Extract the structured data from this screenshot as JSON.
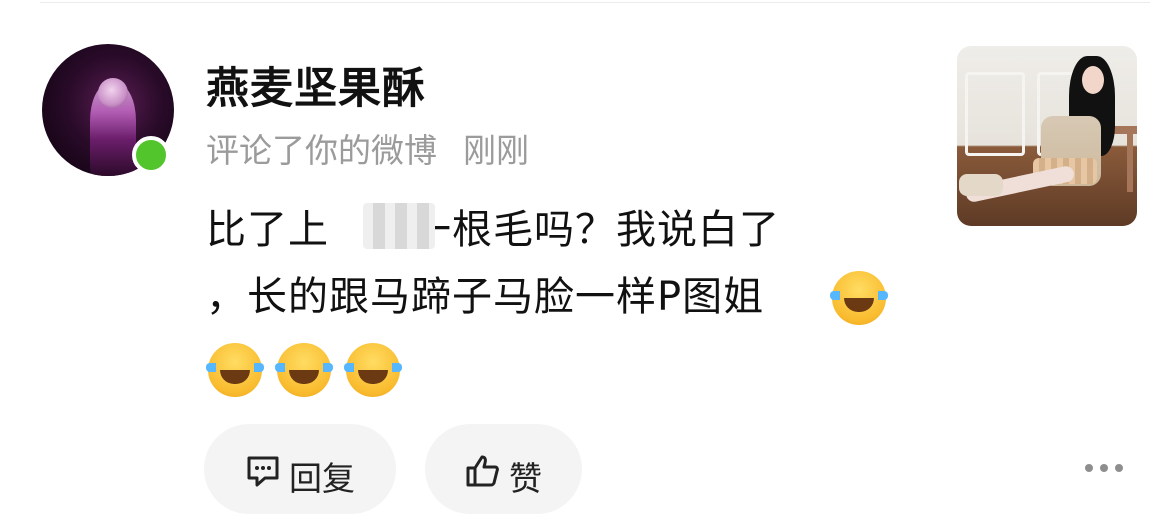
{
  "user": {
    "name": "燕麦坚果酥",
    "action": "评论了你的微博",
    "time": "刚刚",
    "online": true
  },
  "comment": {
    "line1_a": "比了上",
    "line1_b": "一根毛吗？我说白了",
    "line2": "，长的跟马蹄子马脸一样P图姐",
    "emojis": [
      "laughing-with-tears-icon",
      "laughing-with-tears-icon",
      "laughing-with-tears-icon",
      "laughing-with-tears-icon"
    ]
  },
  "actions": {
    "reply_label": "回复",
    "like_label": "赞"
  },
  "colors": {
    "online_dot": "#52c42c",
    "meta_text": "#9b9b9b",
    "button_bg": "#f4f4f4"
  }
}
